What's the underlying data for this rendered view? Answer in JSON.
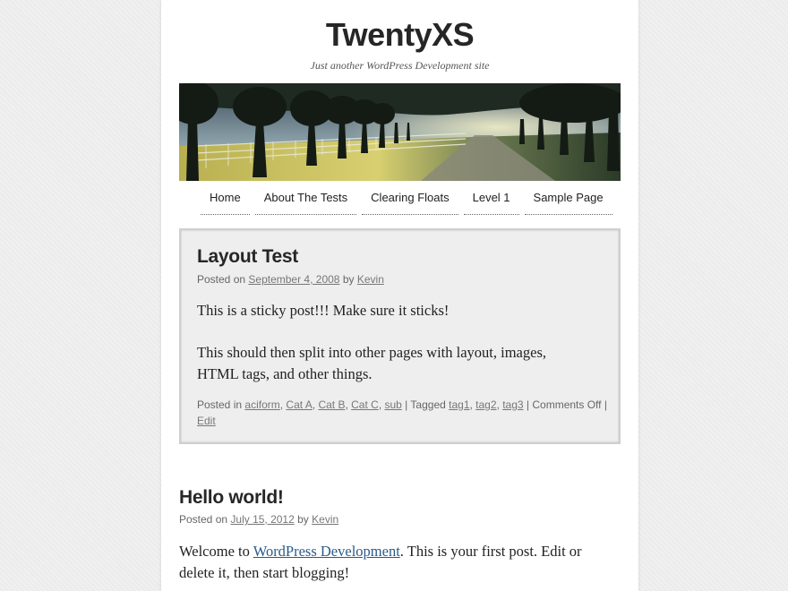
{
  "site": {
    "title": "TwentyXS",
    "tagline": "Just another WordPress Development site"
  },
  "nav": {
    "items": [
      {
        "label": "Home"
      },
      {
        "label": "About The Tests"
      },
      {
        "label": "Clearing Floats"
      },
      {
        "label": "Level 1"
      },
      {
        "label": "Sample Page"
      }
    ]
  },
  "sticky_post": {
    "title": "Layout Test",
    "posted_on": "Posted on",
    "date": "September 4, 2008",
    "by": "by",
    "author": "Kevin",
    "para1": "This is a sticky post!!! Make sure it sticks!",
    "para2_line1": "This should then split into other pages with layout, images,",
    "para2_line2": "HTML tags, and other things.",
    "posted_in": "Posted in",
    "categories": [
      "aciform",
      "Cat A",
      "Cat B",
      "Cat C",
      "sub"
    ],
    "tagged": "Tagged",
    "tags": [
      "tag1",
      "tag2",
      "tag3"
    ],
    "comments": "Comments Off",
    "edit": "Edit"
  },
  "post2": {
    "title": "Hello world!",
    "posted_on": "Posted on",
    "date": "July 15, 2012",
    "by": "by",
    "author": "Kevin",
    "text_start": "Welcome to ",
    "link": "WordPress Development",
    "text_end": ". This is your first post. Edit or",
    "line2": "delete it, then start blogging!"
  },
  "colors": {
    "background": "#ececec",
    "page": "#ffffff",
    "sticky_background": "#eeeeee",
    "link": "#2a5a8a",
    "title": "#262626"
  }
}
